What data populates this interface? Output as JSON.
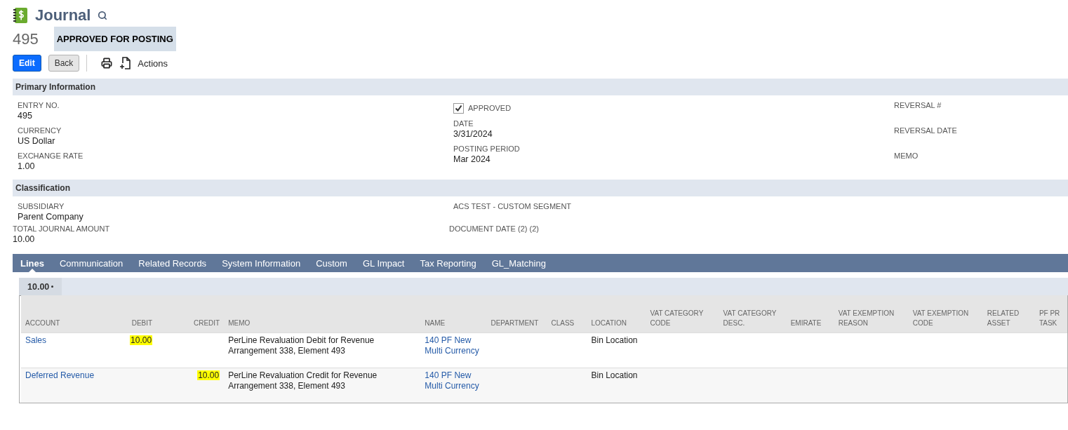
{
  "header": {
    "title": "Journal",
    "number": "495",
    "status": "APPROVED FOR POSTING"
  },
  "toolbar": {
    "buttons": [
      {
        "label": "Edit",
        "kind": "primary"
      },
      {
        "label": "Back",
        "kind": "secondary"
      }
    ],
    "actions": "Actions"
  },
  "primary_information": {
    "title": "Primary Information",
    "columns": [
      [
        {
          "kind": "text",
          "label": "ENTRY NO.",
          "value": "495"
        },
        {
          "kind": "text",
          "label": "CURRENCY",
          "value": "US Dollar"
        },
        {
          "kind": "text",
          "label": "EXCHANGE RATE",
          "value": "1.00"
        }
      ],
      [
        {
          "kind": "checkbox",
          "label": "APPROVED",
          "checked": true
        },
        {
          "kind": "text",
          "label": "DATE",
          "value": "3/31/2024"
        },
        {
          "kind": "text",
          "label": "POSTING PERIOD",
          "value": "Mar 2024"
        }
      ],
      [
        {
          "kind": "text",
          "label": "REVERSAL #"
        },
        {
          "kind": "text",
          "label": "REVERSAL DATE"
        },
        {
          "kind": "text",
          "label": "MEMO"
        }
      ]
    ]
  },
  "classification": {
    "title": "Classification",
    "columns": [
      [
        {
          "kind": "text",
          "label": "SUBSIDIARY",
          "value": "Parent Company"
        }
      ],
      [
        {
          "kind": "text",
          "label": "ACS TEST - CUSTOM SEGMENT"
        }
      ]
    ]
  },
  "extra_fields": [
    {
      "kind": "text",
      "label": "TOTAL JOURNAL AMOUNT",
      "value": "10.00"
    },
    {
      "kind": "text",
      "label": "DOCUMENT DATE (2) (2)"
    }
  ],
  "tabs": [
    {
      "label": "Lines",
      "selected": true
    },
    {
      "label": "Communication",
      "selected": false
    },
    {
      "label": "Related Records",
      "selected": false
    },
    {
      "label": "System Information",
      "selected": false
    },
    {
      "label": "Custom",
      "selected": false
    },
    {
      "label": "GL Impact",
      "selected": false
    },
    {
      "label": "Tax Reporting",
      "selected": false
    },
    {
      "label": "GL_Matching",
      "selected": false
    }
  ],
  "subtabs": [
    {
      "label": "10.00",
      "selected": true
    }
  ],
  "table": {
    "columns": [
      {
        "label": "ACCOUNT",
        "kind": "text"
      },
      {
        "label": "DEBIT",
        "kind": "amount"
      },
      {
        "label": "CREDIT",
        "kind": "amount"
      },
      {
        "label": "MEMO",
        "kind": "text"
      },
      {
        "label": "NAME",
        "kind": "text"
      },
      {
        "label": "DEPARTMENT",
        "kind": "text"
      },
      {
        "label": "CLASS",
        "kind": "text"
      },
      {
        "label": "LOCATION",
        "kind": "text"
      },
      {
        "label": "VAT CATEGORY CODE",
        "kind": "text"
      },
      {
        "label": "VAT CATEGORY DESC.",
        "kind": "text"
      },
      {
        "label": "EMIRATE",
        "kind": "text"
      },
      {
        "label": "VAT EXEMPTION REASON",
        "kind": "text"
      },
      {
        "label": "VAT EXEMPTION CODE",
        "kind": "text"
      },
      {
        "label": "RELATED ASSET",
        "kind": "text"
      },
      {
        "label": "PF PR TASK",
        "kind": "text"
      }
    ],
    "rows": [
      {
        "cells": [
          {
            "text": "Sales",
            "link": true
          },
          {
            "text": "10.00",
            "highlighted": true
          },
          {},
          {
            "text": "PerLine Revaluation Debit for Revenue Arrangement 338, Element 493"
          },
          {
            "text": "140 PF New Multi Currency",
            "link": true
          },
          {},
          {},
          {
            "text": "Bin Location"
          },
          {},
          {},
          {},
          {},
          {},
          {},
          {}
        ]
      },
      {
        "cells": [
          {
            "text": "Deferred Revenue",
            "link": true
          },
          {},
          {
            "text": "10.00",
            "highlighted": true
          },
          {
            "text": "PerLine Revaluation Credit for Revenue Arrangement 338, Element 493"
          },
          {
            "text": "140 PF New Multi Currency",
            "link": true
          },
          {},
          {},
          {
            "text": "Bin Location"
          },
          {},
          {},
          {},
          {},
          {},
          {},
          {}
        ]
      }
    ]
  }
}
